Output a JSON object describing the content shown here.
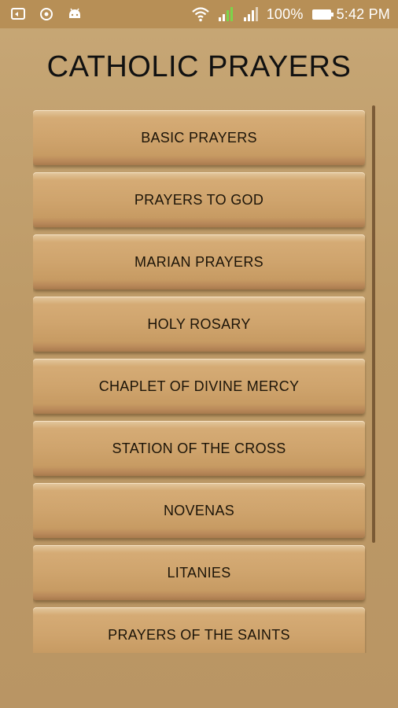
{
  "status_bar": {
    "battery": "100%",
    "time": "5:42 PM",
    "icons": [
      "screen-mirror-icon",
      "sync-icon",
      "android-icon",
      "wifi-icon",
      "signal-icon",
      "signal-icon",
      "battery-icon"
    ]
  },
  "title": "CATHOLIC PRAYERS",
  "menu": {
    "items": [
      "BASIC PRAYERS",
      "PRAYERS TO GOD",
      "MARIAN PRAYERS",
      "HOLY ROSARY",
      "CHAPLET OF DIVINE MERCY",
      "STATION OF THE CROSS",
      "NOVENAS",
      "LITANIES",
      "PRAYERS OF THE SAINTS"
    ]
  },
  "colors": {
    "background": "#c7a776",
    "status_bar": "#b78f56",
    "button": "#cfa46d",
    "text": "#1c1408"
  }
}
